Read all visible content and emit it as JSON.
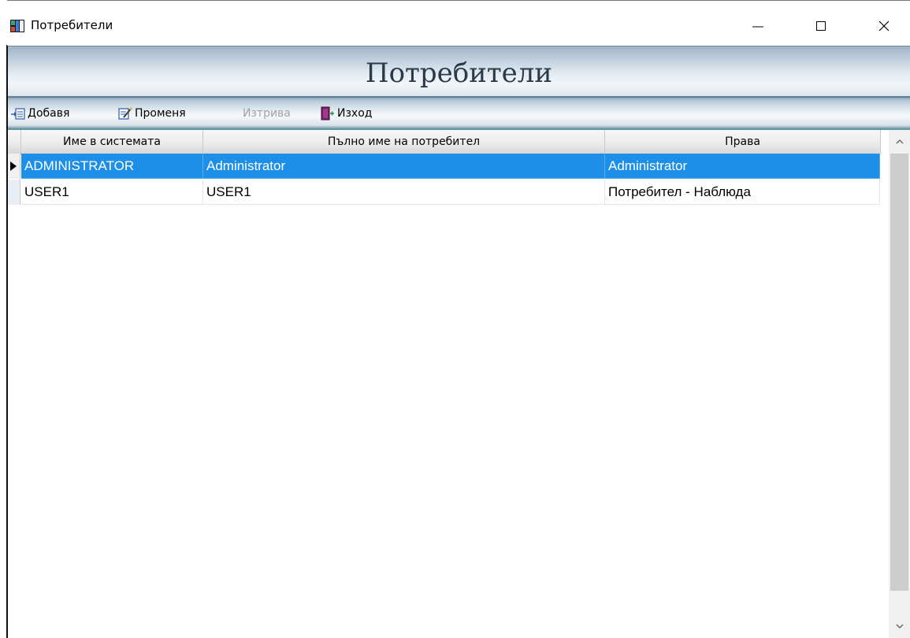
{
  "window": {
    "title": "Потребители",
    "icon": "app-grid-icon"
  },
  "header": {
    "title": "Потребители"
  },
  "toolbar": {
    "add_label": "Добавя",
    "edit_label": "Променя",
    "delete_label": "Изтрива",
    "exit_label": "Изход"
  },
  "grid": {
    "columns": [
      "Име в системата",
      "Пълно име на потребител",
      "Права"
    ],
    "rows": [
      [
        "ADMINISTRATOR",
        "Administrator",
        "Administrator"
      ],
      [
        "USER1",
        "USER1",
        "Потребител - Наблюда"
      ]
    ],
    "selected_row": 0
  },
  "colors": {
    "selection": "#1e8fe8",
    "header_text": "#2a3a4a"
  }
}
